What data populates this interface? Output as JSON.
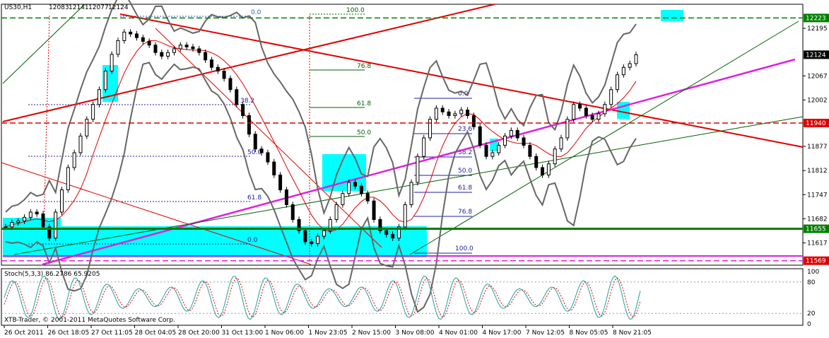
{
  "window": {
    "symbol_header": "US30,H1",
    "ohlc": [
      "12083",
      "12141",
      "12077",
      "12124"
    ],
    "copyright": "XTB-Trader, © 2001-2011 MetaQuotes Software Corp."
  },
  "oscillator": {
    "label": "Stoch(5,3,3) 86.2786 65.9205",
    "ticks": [
      "100",
      "80",
      "20",
      "0"
    ]
  },
  "colors": {
    "background": "#ffffff",
    "trend_red": "#e00000",
    "channel_magenta": "#e020e0",
    "fib_blue": "#2020a0",
    "fib_green": "#006000",
    "box_cyan": "#00ffff",
    "level_green": "#008000",
    "bollinger": "#666666",
    "stoch_main": "#20a0a0",
    "stoch_signal": "#e00000"
  },
  "chart_data": {
    "type": "candlestick",
    "symbol": "US30",
    "timeframe": "H1",
    "ylim": [
      11557,
      12260
    ],
    "y_ticks": [
      12223,
      12195,
      12124,
      12067,
      12002,
      11940,
      11877,
      11812,
      11747,
      11682,
      11655,
      11617,
      11569
    ],
    "x_labels": [
      "26 Oct 2011",
      "26 Oct 18:05",
      "27 Oct 11:05",
      "28 Oct 04:05",
      "28 Oct 20:00",
      "31 Oct 13:00",
      "1 Nov 06:00",
      "1 Nov 23:05",
      "2 Nov 15:00",
      "3 Nov 08:00",
      "4 Nov 01:00",
      "4 Nov 17:00",
      "7 Nov 12:05",
      "8 Nov 05:05",
      "8 Nov 21:05"
    ],
    "price_levels": [
      {
        "value": 12223,
        "label": "12223",
        "kind": "resistance"
      },
      {
        "value": 11940,
        "label": "11940",
        "kind": "dashed-red"
      },
      {
        "value": 11655,
        "label": "11655",
        "kind": "support"
      },
      {
        "value": 11569,
        "label": "11569",
        "kind": "support-magenta"
      }
    ],
    "current_price": {
      "value": 12124,
      "label": "12124"
    },
    "fib_left": [
      "0.0",
      "100.0",
      "76.8",
      "61.8",
      "50.0",
      "38.2",
      "50.0",
      "61.8",
      "0.0"
    ],
    "fib_right": [
      "0.0",
      "23.6",
      "38.2",
      "50.0",
      "61.8",
      "76.8",
      "100.0"
    ],
    "close_path": [
      11660,
      11672,
      11676,
      11686,
      11700,
      11695,
      11660,
      11630,
      11700,
      11760,
      11820,
      11860,
      11905,
      11950,
      11990,
      12030,
      12080,
      12125,
      12162,
      12185,
      12180,
      12170,
      12160,
      12150,
      12130,
      12120,
      12130,
      12140,
      12150,
      12145,
      12140,
      12130,
      12110,
      12090,
      12080,
      12060,
      12030,
      11990,
      11960,
      11910,
      11870,
      11860,
      11835,
      11800,
      11760,
      11720,
      11680,
      11650,
      11620,
      11615,
      11635,
      11650,
      11680,
      11720,
      11750,
      11780,
      11770,
      11750,
      11730,
      11680,
      11650,
      11640,
      11630,
      11660,
      11720,
      11780,
      11850,
      11900,
      11950,
      11980,
      11970,
      11960,
      11965,
      11975,
      11960,
      11930,
      11880,
      11850,
      11860,
      11880,
      11905,
      11920,
      11900,
      11880,
      11850,
      11820,
      11800,
      11830,
      11870,
      11900,
      11950,
      11990,
      11980,
      11960,
      11950,
      11965,
      11990,
      12030,
      12070,
      12090,
      12100,
      12124
    ]
  }
}
